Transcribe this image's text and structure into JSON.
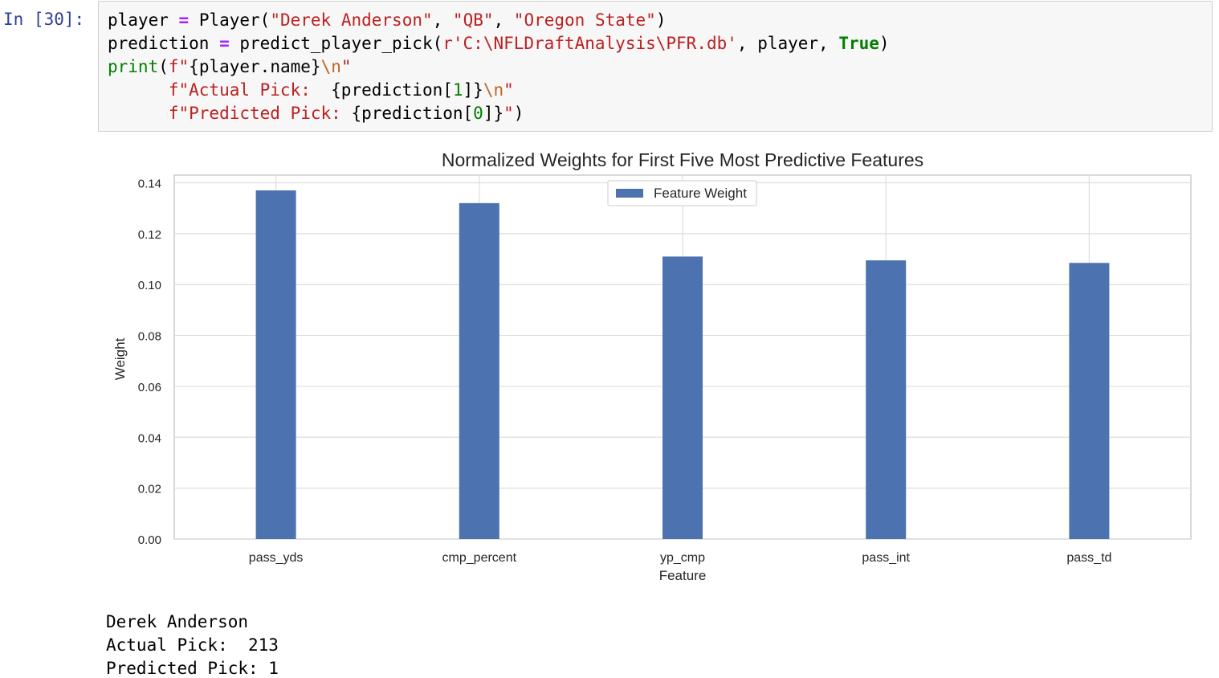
{
  "prompt": "In [30]:",
  "code": {
    "line1": {
      "a": "player ",
      "op": "=",
      "b": " Player(",
      "s1": "\"Derek Anderson\"",
      "c1": ", ",
      "s2": "\"QB\"",
      "c2": ", ",
      "s3": "\"Oregon State\"",
      "e": ")"
    },
    "line2": {
      "a": "prediction ",
      "op": "=",
      "b": " predict_player_pick(",
      "s": "r'C:\\NFLDraftAnalysis\\PFR.db'",
      "c": ", player, ",
      "kw": "True",
      "e": ")"
    },
    "line3": {
      "fn": "print",
      "a": "(",
      "s1": "f\"",
      "i1": "{player.name}",
      "esc": "\\n",
      "s2": "\""
    },
    "line4": {
      "indent": "      ",
      "s1": "f\"Actual Pick:  ",
      "i1": "{prediction[",
      "num": "1",
      "i2": "]}",
      "esc": "\\n",
      "s2": "\""
    },
    "line5": {
      "indent": "      ",
      "s1": "f\"Predicted Pick: ",
      "i1": "{prediction[",
      "num": "0",
      "i2": "]}",
      "s2": "\"",
      "e": ")"
    }
  },
  "chart_data": {
    "type": "bar",
    "title": "Normalized Weights for First Five Most Predictive Features",
    "xlabel": "Feature",
    "ylabel": "Weight",
    "categories": [
      "pass_yds",
      "cmp_percent",
      "yp_cmp",
      "pass_int",
      "pass_td"
    ],
    "series": [
      {
        "name": "Feature Weight",
        "values": [
          0.137,
          0.132,
          0.111,
          0.1095,
          0.1085
        ],
        "color": "#4c72b0"
      }
    ],
    "ylim": [
      0,
      0.143
    ],
    "yticks": [
      "0.00",
      "0.02",
      "0.04",
      "0.06",
      "0.08",
      "0.10",
      "0.12",
      "0.14"
    ],
    "grid": true,
    "legend": "upper-center"
  },
  "output": {
    "line1": "Derek Anderson",
    "line2": "Actual Pick:  213",
    "line3": "Predicted Pick: 1"
  }
}
